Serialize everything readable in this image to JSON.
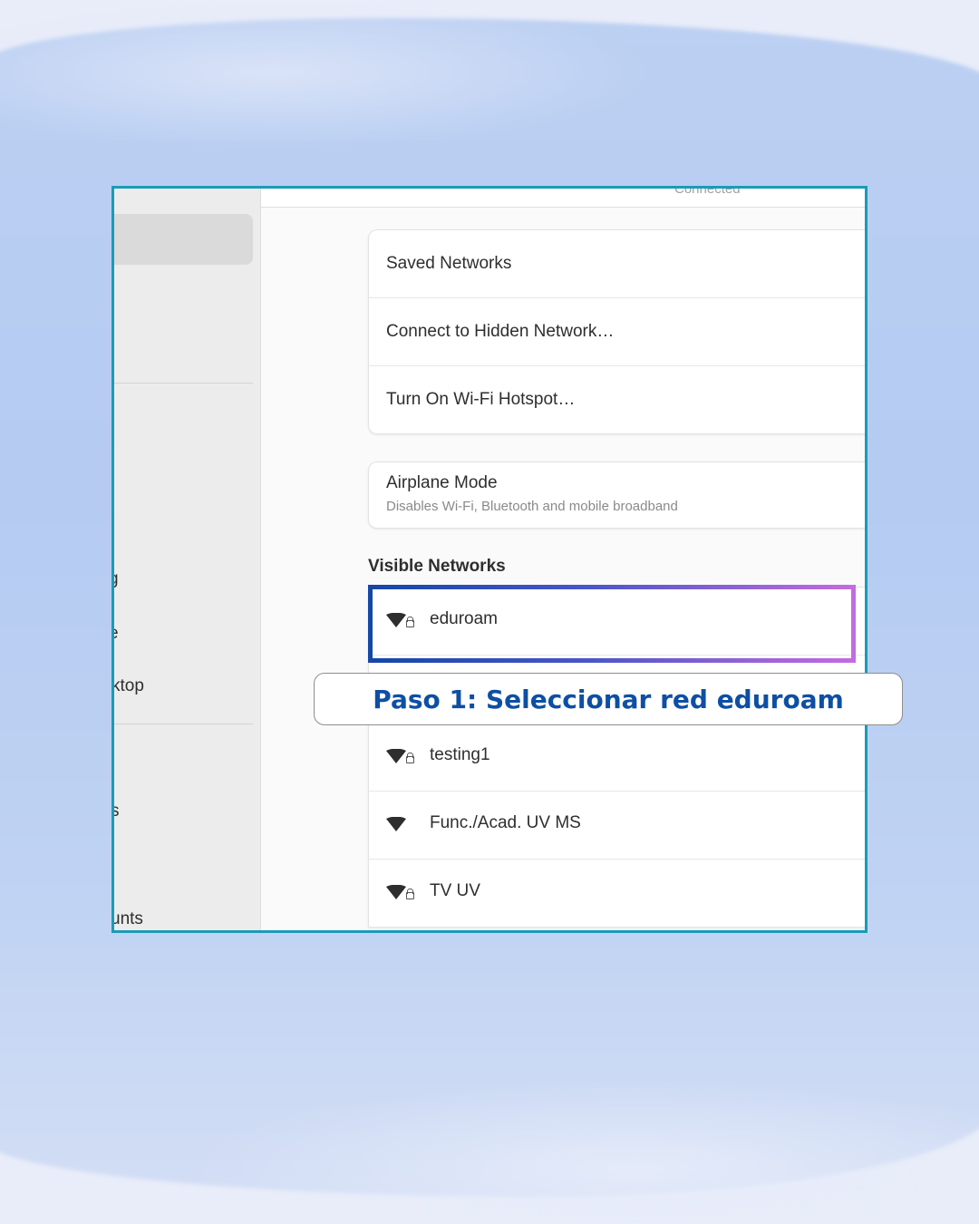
{
  "background": {
    "color": "#e9edf9",
    "wash": "#b8ccf2",
    "frame_border": "#1a9bb7"
  },
  "sidebar": {
    "items": [
      {
        "label": "g"
      },
      {
        "label": "e"
      },
      {
        "label": "ktop"
      },
      {
        "label": "s"
      },
      {
        "label": "unts"
      }
    ]
  },
  "topbar": {
    "status": "Connected"
  },
  "wifi_menu": {
    "items": [
      {
        "label": "Saved Networks"
      },
      {
        "label": "Connect to Hidden Network…"
      },
      {
        "label": "Turn On Wi-Fi Hotspot…"
      }
    ]
  },
  "airplane": {
    "title": "Airplane Mode",
    "subtitle": "Disables Wi-Fi, Bluetooth and mobile broadband"
  },
  "visible_networks": {
    "title": "Visible Networks",
    "networks": [
      {
        "name": "eduroam",
        "icon": "wifi-secure-icon"
      },
      {
        "name": "",
        "icon": ""
      },
      {
        "name": "testing1",
        "icon": "wifi-secure-icon"
      },
      {
        "name": "Func./Acad. UV MS",
        "icon": "wifi-icon"
      },
      {
        "name": "TV UV",
        "icon": "wifi-secure-icon"
      }
    ]
  },
  "callout": {
    "text": "Paso 1: Seleccionar red eduroam",
    "color": "#0d4fa4"
  }
}
